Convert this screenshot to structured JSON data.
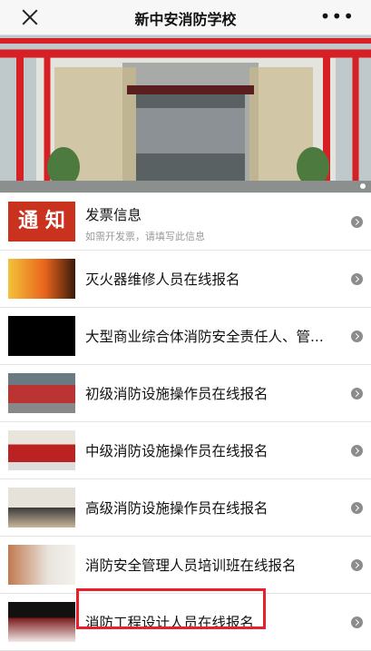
{
  "header": {
    "title": "新中安消防学校",
    "more": "•••"
  },
  "items": [
    {
      "title": "发票信息",
      "subtitle": "如需开发票，请填写此信息",
      "thumb_text": "通 知"
    },
    {
      "title": "灭火器维修人员在线报名"
    },
    {
      "title": "大型商业综合体消防安全责任人、管..."
    },
    {
      "title": "初级消防设施操作员在线报名"
    },
    {
      "title": "中级消防设施操作员在线报名"
    },
    {
      "title": "高级消防设施操作员在线报名"
    },
    {
      "title": "消防安全管理人员培训班在线报名"
    },
    {
      "title": "消防工程设计人员在线报名"
    }
  ],
  "colors": {
    "highlight": "#e8202a",
    "pipe_red": "#d62026"
  }
}
